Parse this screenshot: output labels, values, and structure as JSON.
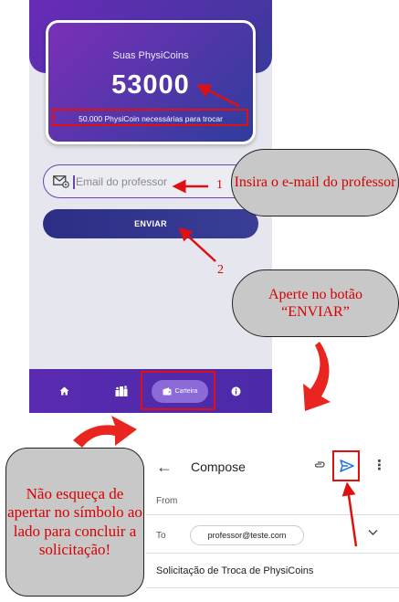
{
  "app": {
    "balance_label": "Suas PhysiCoins",
    "balance_value": "53000",
    "requirement_note": "50.000 PhysiCoin necessárias para trocar",
    "email_placeholder": "Email do professor",
    "send_button": "ENVIAR",
    "nav": {
      "home_icon": "home-icon",
      "ranking_icon": "ranking-icon",
      "wallet_label": "Carteira",
      "wallet_icon": "wallet-icon",
      "info_icon": "info-icon"
    }
  },
  "annotations": {
    "step1_number": "1",
    "step2_number": "2",
    "callout_email": "Insira o e-mail do professor",
    "callout_send": "Aperte no botão “ENVIAR”",
    "callout_finish": "Não esqueça de apertar no símbolo ao lado para concluir a solicitação!"
  },
  "compose": {
    "title": "Compose",
    "from_label": "From",
    "to_label": "To",
    "recipient": "professor@teste.com",
    "subject": "Solicitação de Troca de PhysiCoins"
  },
  "colors": {
    "highlight": "#e01010",
    "callout_text": "#d80000",
    "callout_bg": "#c8c8c8",
    "card_gradient_start": "#7b2fb8",
    "card_gradient_end": "#2e3d9c",
    "nav_bg": "#5a2ab0",
    "send_icon": "#1a73e8"
  }
}
